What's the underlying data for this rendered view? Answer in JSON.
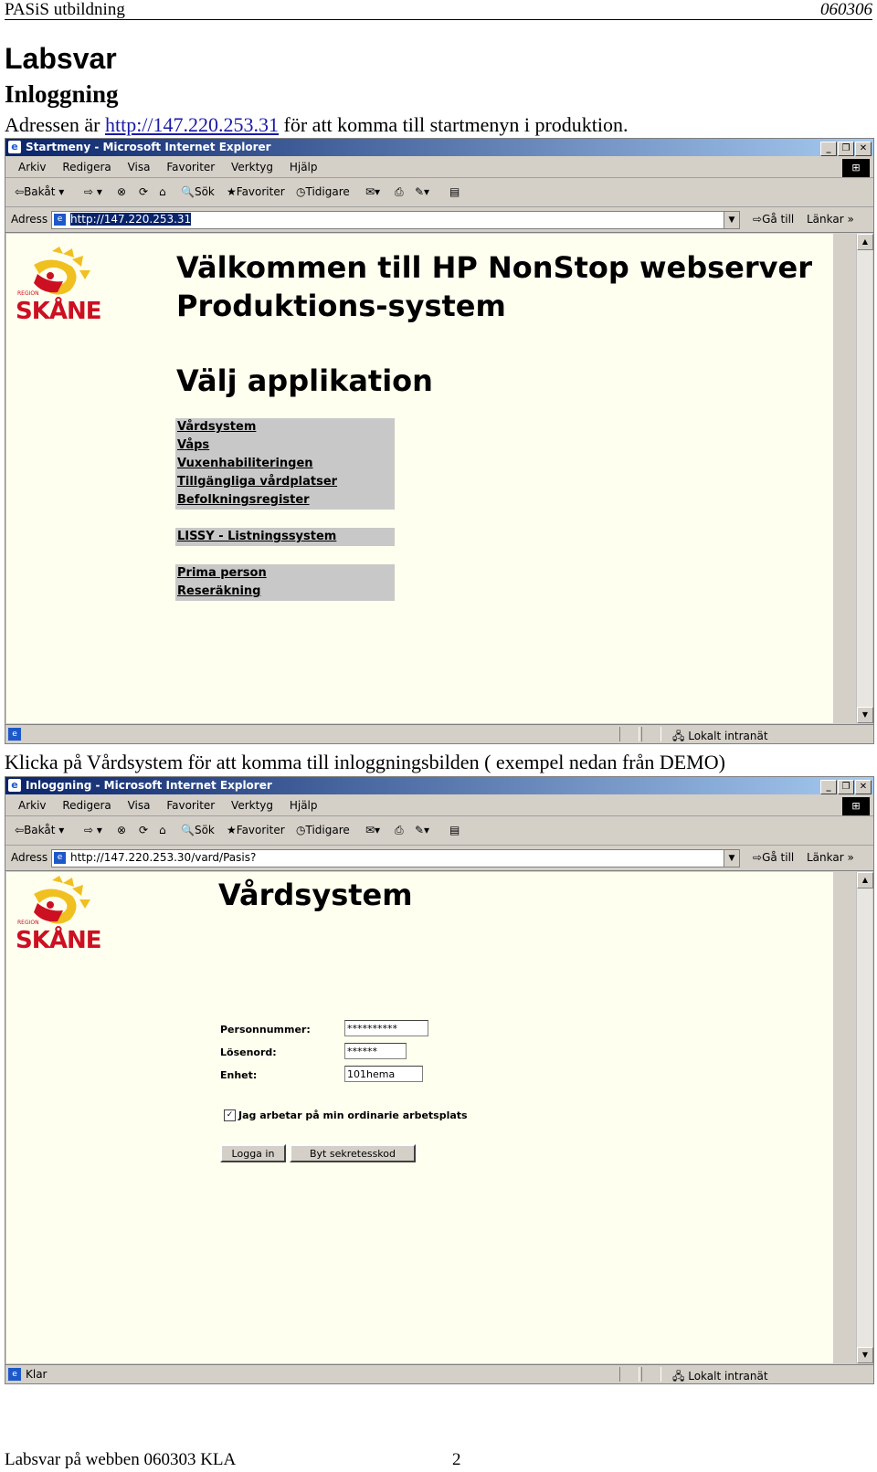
{
  "doc": {
    "header_left": "PASiS utbildning",
    "header_right": "060306",
    "title": "Labsvar",
    "subtitle": "Inloggning",
    "intro_prefix": "Adressen är ",
    "intro_link": "http://147.220.253.31",
    "intro_suffix": " för att komma till startmenyn i produktion.",
    "instruction": "Klicka på Vårdsystem för att komma till inloggningsbilden ( exempel nedan från DEMO)",
    "footer_left": "Labsvar på webben 060303 KLA",
    "footer_page": "2"
  },
  "browser": {
    "menu": [
      "Arkiv",
      "Redigera",
      "Visa",
      "Favoriter",
      "Verktyg",
      "Hjälp"
    ],
    "toolbar": {
      "back": "Bakåt",
      "search": "Sök",
      "favorites": "Favoriter",
      "history": "Tidigare"
    },
    "address_label": "Adress",
    "go_label": "Gå till",
    "links_label": "Länkar",
    "zone": "Lokalt intranät"
  },
  "window1": {
    "title": "Startmeny - Microsoft Internet Explorer",
    "url": "http://147.220.253.31",
    "status": ""
  },
  "window2": {
    "title": "Inloggning - Microsoft Internet Explorer",
    "url": "http://147.220.253.30/vard/Pasis?",
    "status": "Klar"
  },
  "logo": {
    "text": "SKÅNE",
    "small": "REGION",
    "colors": {
      "red": "#cc1022",
      "yellow": "#f0c020"
    }
  },
  "startpage": {
    "heading1": "Välkommen till HP NonStop webserver",
    "heading2": "Produktions-system",
    "choose": "Välj applikation",
    "group1": [
      "Vårdsystem",
      "Våps",
      "Vuxenhabiliteringen",
      "Tillgängliga vårdplatser",
      "Befolkningsregister"
    ],
    "group2": [
      "LISSY - Listningssystem"
    ],
    "group3": [
      "Prima person",
      "Reseräkning"
    ]
  },
  "loginpage": {
    "heading": "Vårdsystem",
    "personnummer_label": "Personnummer:",
    "personnummer_value": "**********",
    "password_label": "Lösenord:",
    "password_value": "******",
    "unit_label": "Enhet:",
    "unit_value": "101hema",
    "checkbox_label": "Jag arbetar på min ordinarie arbetsplats",
    "login_button": "Logga in",
    "change_button": "Byt sekretesskod"
  }
}
